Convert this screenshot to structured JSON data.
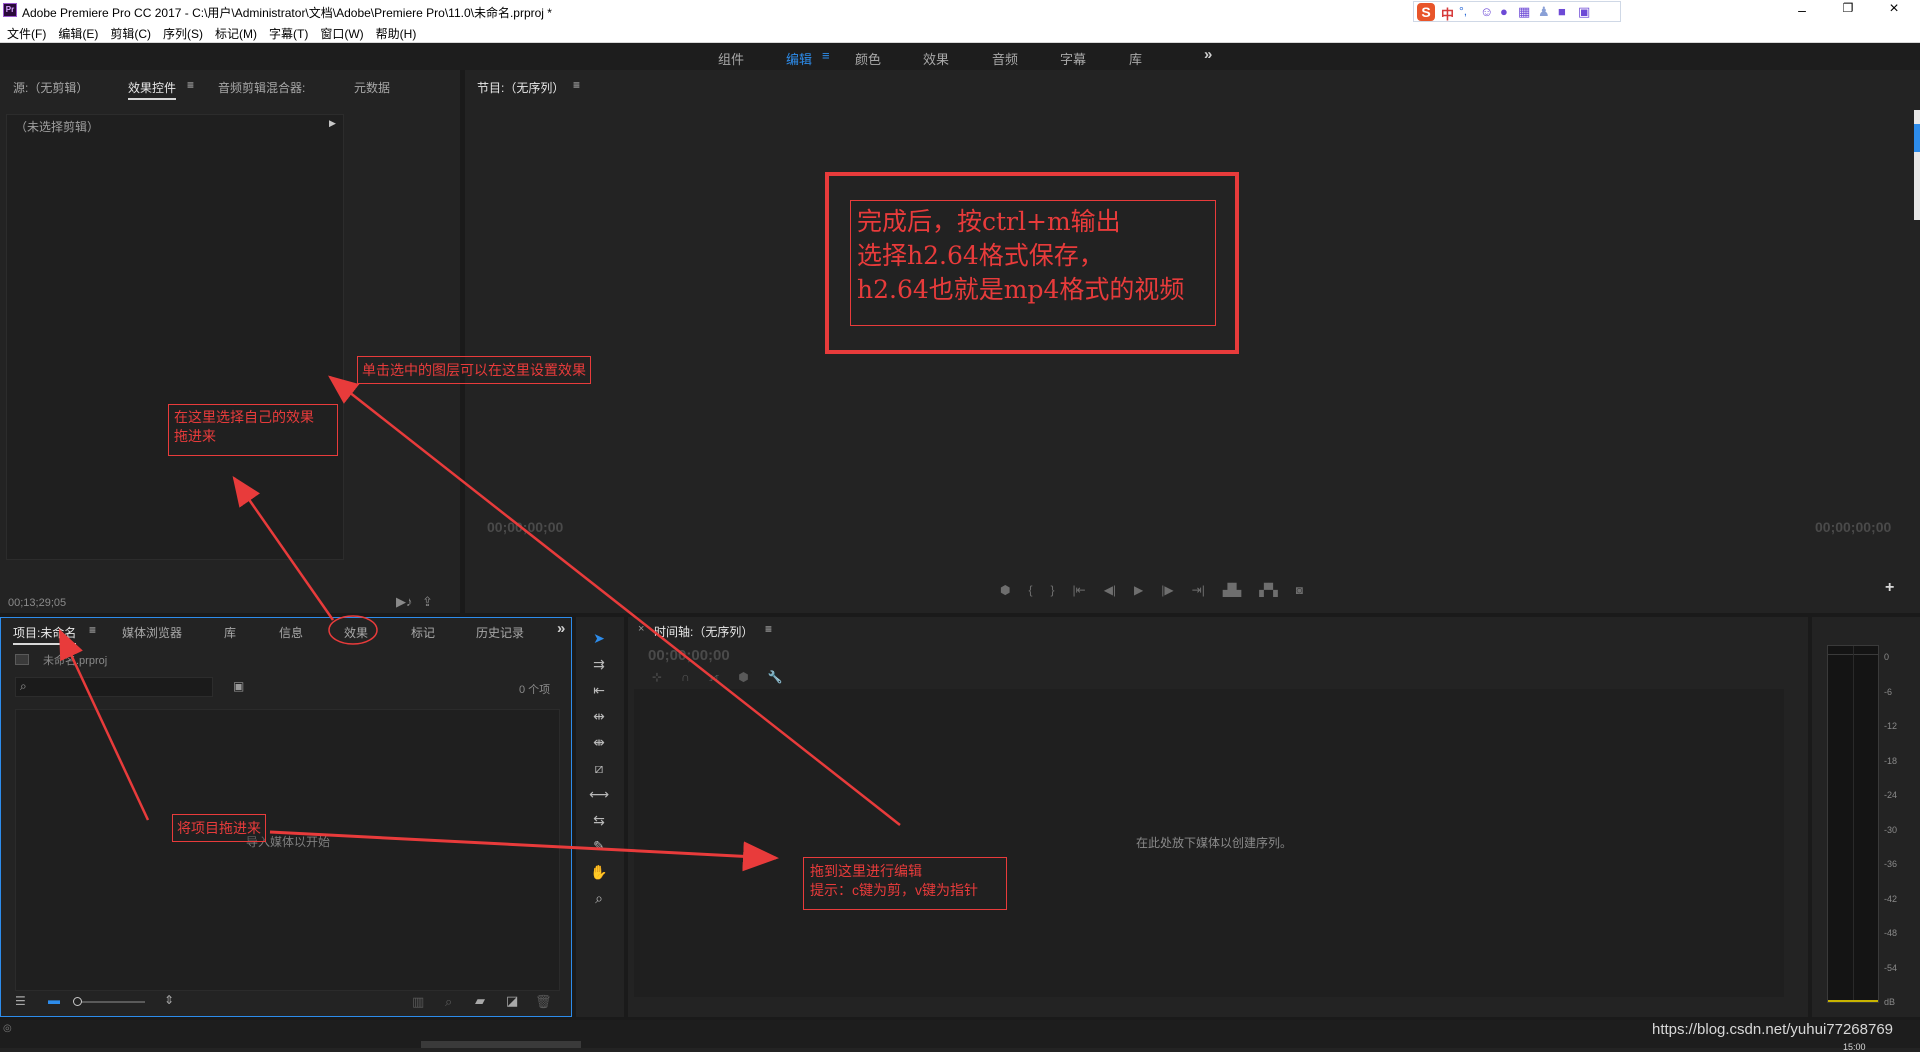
{
  "app": {
    "title": "Adobe Premiere Pro CC 2017 - C:\\用户\\Administrator\\文档\\Adobe\\Premiere Pro\\11.0\\未命名.prproj *",
    "logo": "Pr"
  },
  "menu": [
    "文件(F)",
    "编辑(E)",
    "剪辑(C)",
    "序列(S)",
    "标记(M)",
    "字幕(T)",
    "窗口(W)",
    "帮助(H)"
  ],
  "ime": {
    "logo": "S",
    "label": "中",
    "punct": "°,"
  },
  "workspaces": {
    "items": [
      "组件",
      "编辑",
      "颜色",
      "效果",
      "音频",
      "字幕",
      "库"
    ],
    "active": "编辑"
  },
  "source_panel": {
    "tabs": [
      "源:（无剪辑）",
      "效果控件",
      "音频剪辑混合器:",
      "元数据"
    ],
    "no_clip": "（未选择剪辑）",
    "timecode": "00;13;29;05"
  },
  "program_monitor": {
    "title": "节目:（无序列）",
    "tc_left": "00;00;00;00",
    "tc_right": "00;00;00;00"
  },
  "project_panel": {
    "tabs": [
      "项目:未命名",
      "媒体浏览器",
      "库",
      "信息",
      "效果",
      "标记",
      "历史记录"
    ],
    "file": "未命名.prproj",
    "count": "0 个项",
    "empty_hint": "导入媒体以开始"
  },
  "timeline": {
    "title": "时间轴:（无序列）",
    "timecode": "00;00;00;00",
    "drop_hint": "在此处放下媒体以创建序列。"
  },
  "meter": {
    "scale": [
      "0",
      "-6",
      "-12",
      "-18",
      "-24",
      "-30",
      "-36",
      "-42",
      "-48",
      "-54",
      "dB"
    ]
  },
  "annotations": {
    "export_note": [
      "完成后，按ctrl+m输出",
      "选择h2.64格式保存，",
      "h2.64也就是mp4格式的视频"
    ],
    "effect_controls_note": "单击选中的图层可以在这里设置效果",
    "effects_note": [
      "在这里选择自己的效果",
      "拖进来"
    ],
    "project_note": "将项目拖进来",
    "timeline_note": [
      "拖到这里进行编辑",
      "提示：c键为剪，v键为指针"
    ]
  },
  "watermark": "https://blog.csdn.net/yuhui77268769",
  "clock": "15:00",
  "colors": {
    "accent": "#2d8ceb",
    "annotation": "#e83b3b",
    "panel": "#232323",
    "frame": "#1a1a1a"
  }
}
